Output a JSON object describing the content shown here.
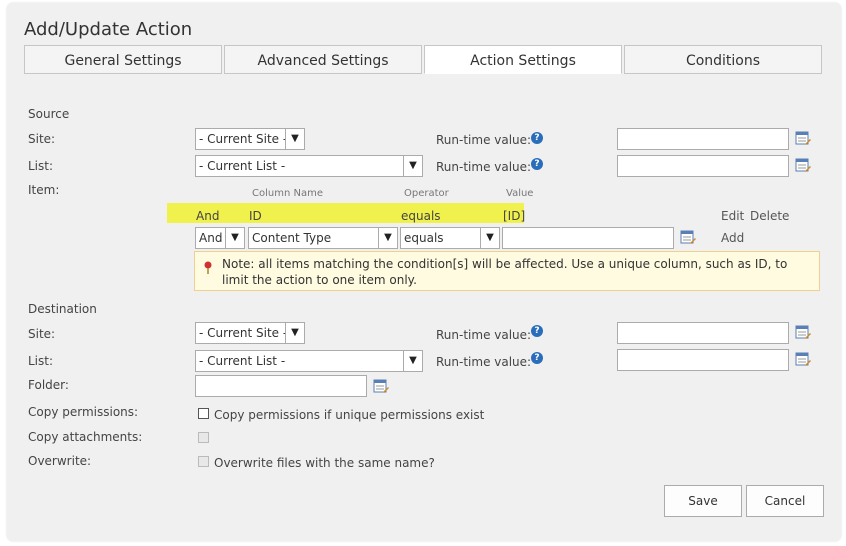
{
  "dialog": {
    "title": "Add/Update Action"
  },
  "tabs": [
    {
      "label": "General Settings"
    },
    {
      "label": "Advanced Settings"
    },
    {
      "label": "Action Settings"
    },
    {
      "label": "Conditions"
    }
  ],
  "active_tab": "Action Settings",
  "source": {
    "heading": "Source",
    "site_label": "Site:",
    "site_value": "- Current Site -",
    "list_label": "List:",
    "list_value": "- Current List -",
    "item_label": "Item:",
    "runtime_label": "Run-time value:"
  },
  "conditions_table": {
    "headers": {
      "column": "Column Name",
      "operator": "Operator",
      "value": "Value"
    },
    "existing_row": {
      "join": "And",
      "column": "ID",
      "operator": "equals",
      "value": "[ID]",
      "edit": "Edit",
      "delete": "Delete"
    },
    "new_row": {
      "join": "And",
      "column": "Content Type",
      "operator": "equals",
      "value": "",
      "add": "Add"
    }
  },
  "note": {
    "text": "Note: all items matching the condition[s] will be affected. Use a unique column, such as ID, to limit the action to one item only."
  },
  "destination": {
    "heading": "Destination",
    "site_label": "Site:",
    "site_value": "- Current Site -",
    "list_label": "List:",
    "list_value": "- Current List -",
    "folder_label": "Folder:",
    "folder_value": "",
    "runtime_label": "Run-time value:"
  },
  "options": {
    "copy_permissions_label": "Copy permissions:",
    "copy_permissions_text": "Copy permissions if unique permissions exist",
    "copy_attachments_label": "Copy attachments:",
    "overwrite_label": "Overwrite:",
    "overwrite_text": "Overwrite files with the same name?"
  },
  "buttons": {
    "save": "Save",
    "cancel": "Cancel"
  },
  "icons": {
    "help": "help-icon",
    "picker": "lookup-picker-icon",
    "note": "pin-icon"
  },
  "colors": {
    "highlight": "#f1f14d",
    "help_blue": "#2a6ebb",
    "note_bg": "#fffbe0"
  }
}
